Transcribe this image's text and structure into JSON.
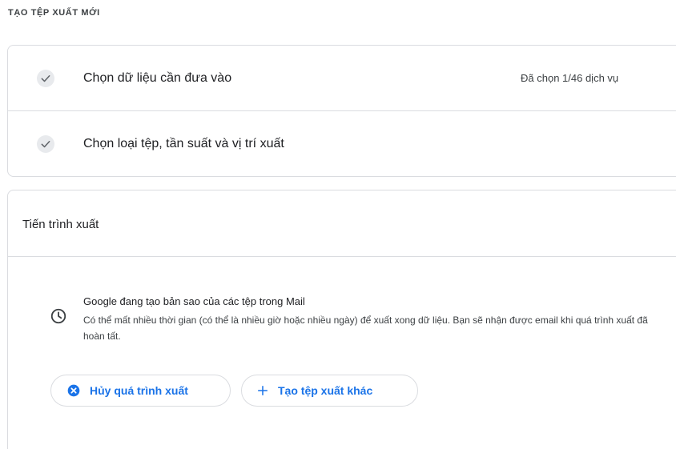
{
  "page": {
    "heading": "TẠO TỆP XUẤT MỚI"
  },
  "steps": [
    {
      "label": "Chọn dữ liệu cần đưa vào",
      "status": "Đã chọn 1/46 dịch vụ",
      "icon": "check-icon",
      "completed": true
    },
    {
      "label": "Chọn loại tệp, tần suất và vị trí xuất",
      "status": "",
      "icon": "check-icon",
      "completed": true
    }
  ],
  "progress": {
    "title": "Tiến trình xuất",
    "icon": "clock-icon",
    "message_title": "Google đang tạo bản sao của các tệp trong Mail",
    "message_body": "Có thể mất nhiều thời gian (có thể là nhiều giờ hoặc nhiều ngày) để xuất xong dữ liệu. Bạn sẽ nhận được email khi quá trình xuất đã hoàn tất.",
    "buttons": {
      "cancel": {
        "label": "Hủy quá trình xuất",
        "icon": "cancel-circle-icon"
      },
      "new_export": {
        "label": "Tạo tệp xuất khác",
        "icon": "plus-icon"
      }
    }
  },
  "colors": {
    "accent": "#1a73e8",
    "border": "#dadce0",
    "check_bg": "#e8eaed",
    "check_mark": "#5f6368",
    "text_primary": "#202124",
    "text_secondary": "#3c4043"
  }
}
